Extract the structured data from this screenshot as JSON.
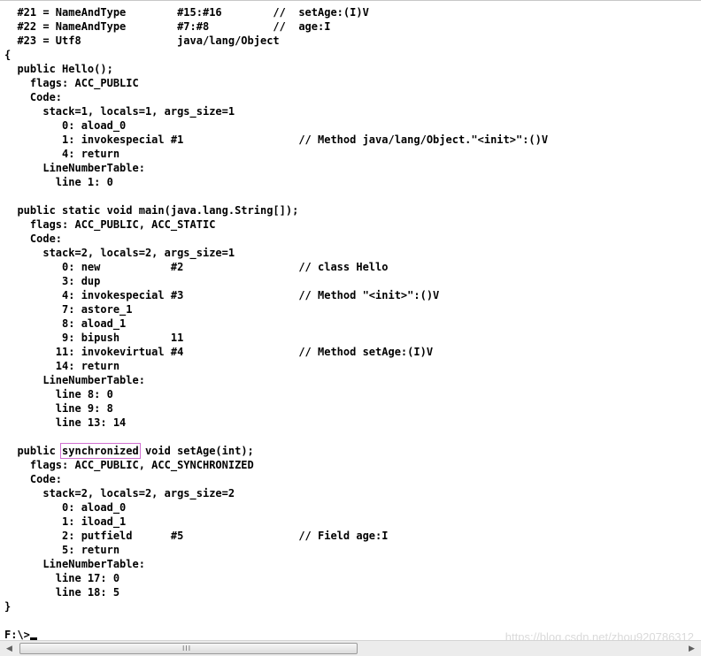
{
  "console": {
    "lines": [
      "  #21 = NameAndType        #15:#16        //  setAge:(I)V",
      "  #22 = NameAndType        #7:#8          //  age:I",
      "  #23 = Utf8               java/lang/Object",
      "{",
      "  public Hello();",
      "    flags: ACC_PUBLIC",
      "    Code:",
      "      stack=1, locals=1, args_size=1",
      "         0: aload_0",
      "         1: invokespecial #1                  // Method java/lang/Object.\"<init>\":()V",
      "         4: return",
      "      LineNumberTable:",
      "        line 1: 0",
      "",
      "  public static void main(java.lang.String[]);",
      "    flags: ACC_PUBLIC, ACC_STATIC",
      "    Code:",
      "      stack=2, locals=2, args_size=1",
      "         0: new           #2                  // class Hello",
      "         3: dup",
      "         4: invokespecial #3                  // Method \"<init>\":()V",
      "         7: astore_1",
      "         8: aload_1",
      "         9: bipush        11",
      "        11: invokevirtual #4                  // Method setAge:(I)V",
      "        14: return",
      "      LineNumberTable:",
      "        line 8: 0",
      "        line 9: 8",
      "        line 13: 14",
      "",
      "  public synchronized void setAge(int);",
      "    flags: ACC_PUBLIC, ACC_SYNCHRONIZED",
      "    Code:",
      "      stack=2, locals=2, args_size=2",
      "         0: aload_0",
      "         1: iload_1",
      "         2: putfield      #5                  // Field age:I",
      "         5: return",
      "      LineNumberTable:",
      "        line 17: 0",
      "        line 18: 5",
      "}"
    ],
    "highlight": {
      "line_index": 31,
      "before": "  public ",
      "word": "synchronized",
      "after": " void setAge(int);"
    },
    "prompt": "F:\\>",
    "watermark": "https://blog.csdn.net/zhou920786312"
  },
  "scrollbar": {
    "left_arrow": "◀",
    "right_arrow": "▶",
    "grip": "III"
  },
  "colors": {
    "background": "#ffffff",
    "text": "#000000",
    "highlight_box": "#d070d0"
  }
}
